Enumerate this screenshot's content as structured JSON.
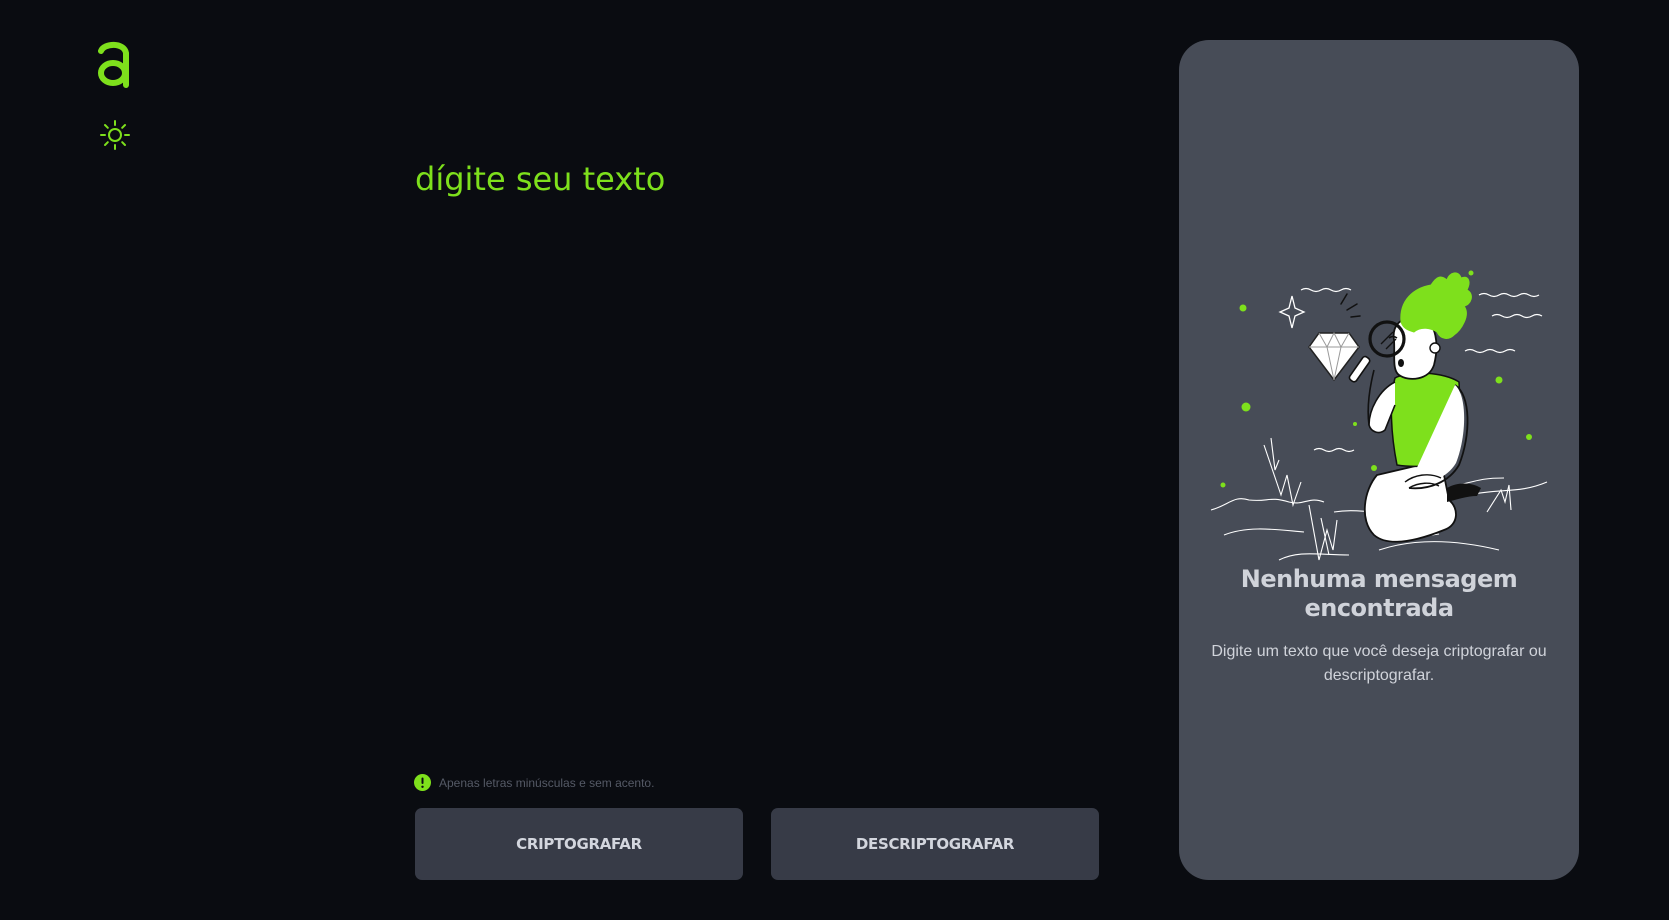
{
  "logo": {
    "glyph": "a",
    "color": "#7ee01c"
  },
  "theme_toggle": {
    "icon": "sun-icon"
  },
  "input": {
    "placeholder": "dígite seu texto",
    "value": ""
  },
  "hint": {
    "icon": "exclamation-circle-icon",
    "text": "Apenas letras minúsculas e sem acento."
  },
  "buttons": {
    "encrypt_label": "CRIPTOGRAFAR",
    "decrypt_label": "DESCRIPTOGRAFAR"
  },
  "output": {
    "illustration": "person-with-magnifier-illustration",
    "title": "Nenhuma mensagem encontrada",
    "description": "Digite um texto que você deseja criptografar ou descriptografar."
  },
  "colors": {
    "background": "#0a0c11",
    "accent": "#7ee01c",
    "button": "#373b47",
    "panel": "#474c57",
    "text_light": "#d0d3da"
  }
}
